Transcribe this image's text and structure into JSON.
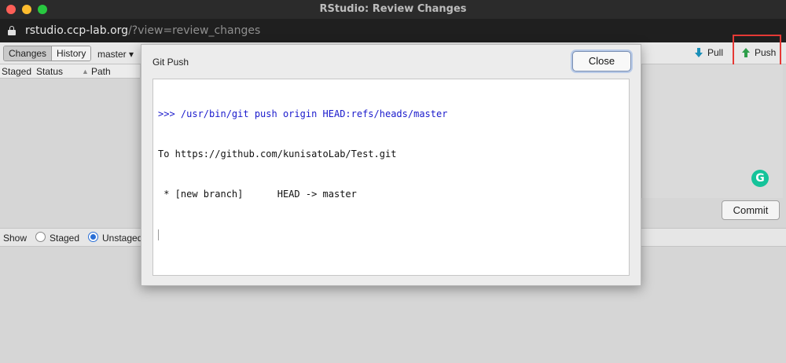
{
  "window": {
    "title": "RStudio: Review Changes"
  },
  "address_bar": {
    "host": "rstudio.ccp-lab.org",
    "path": "/?view=review_changes"
  },
  "toolbar": {
    "changes_tab": "Changes",
    "history_tab": "History",
    "branch": "master",
    "branch_arrow": "▾",
    "pull_label": "Pull",
    "push_label": "Push"
  },
  "file_table": {
    "columns": [
      "Staged",
      "Status",
      "Path"
    ],
    "sort_glyph": "▲"
  },
  "commit": {
    "button_label": "Commit"
  },
  "show_bar": {
    "label": "Show",
    "staged_label": "Staged",
    "unstaged_label": "Unstaged",
    "selected": "unstaged"
  },
  "dialog": {
    "title": "Git Push",
    "close_label": "Close",
    "console_lines": [
      {
        "kind": "command",
        "text": ">>> /usr/bin/git push origin HEAD:refs/heads/master"
      },
      {
        "kind": "output",
        "text": "To https://github.com/kunisatoLab/Test.git"
      },
      {
        "kind": "output",
        "text": " * [new branch]      HEAD -> master"
      }
    ]
  },
  "icons": {
    "pull": "pull-arrow-down-icon",
    "push": "push-arrow-up-icon",
    "lock": "lock-icon",
    "grammarly": "grammarly-icon"
  },
  "colors": {
    "pull_arrow": "#1a8fb8",
    "push_arrow": "#2e9e4a",
    "highlight": "#e53935",
    "command_text": "#1a1acc"
  }
}
